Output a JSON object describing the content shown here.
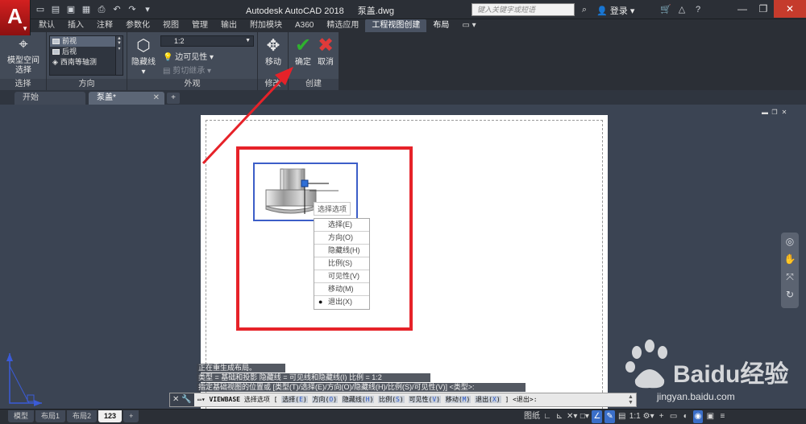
{
  "window": {
    "app_title": "Autodesk AutoCAD 2018",
    "file_title": "泵盖.dwg",
    "search_placeholder": "键入关键字或短语",
    "login": "登录"
  },
  "ribbon_tabs": [
    {
      "label": "默认"
    },
    {
      "label": "插入"
    },
    {
      "label": "注释"
    },
    {
      "label": "参数化"
    },
    {
      "label": "视图"
    },
    {
      "label": "管理"
    },
    {
      "label": "输出"
    },
    {
      "label": "附加模块"
    },
    {
      "label": "A360"
    },
    {
      "label": "精选应用"
    },
    {
      "label": "工程视图创建"
    },
    {
      "label": "布局"
    }
  ],
  "ribbon": {
    "select_panel": {
      "button": "模型空间\n选择",
      "title": "选择"
    },
    "orientation_panel": {
      "title": "方向",
      "items": [
        {
          "label": "前视"
        },
        {
          "label": "后视"
        },
        {
          "label": "西南等轴测"
        }
      ]
    },
    "appearance_panel": {
      "title": "外观",
      "hidden_lines": "隐藏线",
      "scale": "1:2",
      "edge_visibility": "边可见性",
      "cut_inherit": "剪切继承"
    },
    "modify_panel": {
      "move": "移动",
      "title": "修改"
    },
    "create_panel": {
      "ok": "确定",
      "cancel": "取消",
      "title": "创建"
    }
  },
  "doc_tabs": [
    {
      "label": "开始"
    },
    {
      "label": "泵盖*"
    }
  ],
  "canvas": {
    "hint": "选择选项",
    "menu": [
      {
        "label": "选择(E)"
      },
      {
        "label": "方向(O)"
      },
      {
        "label": "隐藏线(H)"
      },
      {
        "label": "比例(S)"
      },
      {
        "label": "可见性(V)"
      },
      {
        "label": "移动(M)"
      },
      {
        "label": "退出(X)",
        "checked": true
      }
    ]
  },
  "command": {
    "history": [
      "正在重生成布局。",
      "类型 = 基础和投影  隐藏线 = 可见线和隐藏线(I)  比例 = 1:2",
      "指定基础视图的位置或 [类型(T)/选择(E)/方向(O)/隐藏线(H)/比例(S)/可见性(V)] <类型>:"
    ],
    "name": "VIEWBASE",
    "prompt": "选择选项",
    "options": [
      {
        "text": "选择",
        "key": "E"
      },
      {
        "text": "方向",
        "key": "O"
      },
      {
        "text": "隐藏线",
        "key": "H"
      },
      {
        "text": "比例",
        "key": "S"
      },
      {
        "text": "可见性",
        "key": "V"
      },
      {
        "text": "移动",
        "key": "M"
      },
      {
        "text": "退出",
        "key": "X"
      }
    ],
    "default": "<退出>:"
  },
  "layout_tabs": [
    {
      "label": "模型"
    },
    {
      "label": "布局1"
    },
    {
      "label": "布局2"
    },
    {
      "label": "123"
    }
  ],
  "status": {
    "paper": "图纸",
    "scale": "1:1"
  },
  "watermark": {
    "text": "Baidu经验",
    "url": "jingyan.baidu.com"
  },
  "colors": {
    "accent_red": "#e62229",
    "ok_green": "#2fb12f",
    "cancel_red": "#e03a3a",
    "selection_blue": "#3c5ec8"
  }
}
